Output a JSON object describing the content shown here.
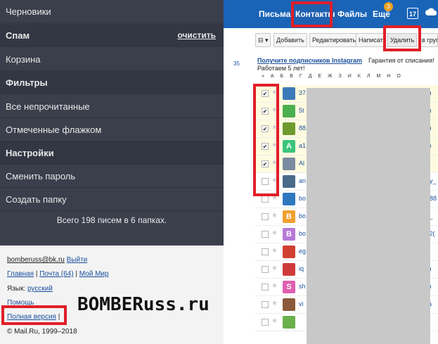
{
  "header": {
    "nav": [
      {
        "label": "Письма"
      },
      {
        "label": "Контакты"
      },
      {
        "label": "Файлы"
      },
      {
        "label": "Ещё"
      }
    ],
    "more_badge": "3",
    "calendar_day": "17",
    "cloud_icon": "cloud-icon"
  },
  "toolbar": {
    "select_label": "⊟ ▾",
    "add_label": "Добавить",
    "edit_label": "Редактировать",
    "write_label": "Написать",
    "delete_label": "Удалить",
    "group_label": "в групп"
  },
  "promo": {
    "link_text": "Получите подписчиков Instagram",
    "text": "Гарантия от списания!",
    "text2": "Работаем 5 лет!"
  },
  "left_count": "35",
  "alphabet": [
    "«",
    "А",
    "Б",
    "В",
    "Г",
    "Д",
    "Е",
    "Ж",
    "З",
    "И",
    "К",
    "Л",
    "М",
    "Н",
    "О"
  ],
  "contacts": [
    {
      "checked": true,
      "letter": "",
      "color": "#3d7ab8",
      "name": "37",
      "edge": "m"
    },
    {
      "checked": true,
      "letter": "",
      "color": "#4caf50",
      "name": "5t",
      "edge": "m"
    },
    {
      "checked": true,
      "letter": "",
      "color": "#6e9a2e",
      "name": "88",
      "edge": "m"
    },
    {
      "checked": true,
      "letter": "A",
      "color": "#3cc47c",
      "name": "a1",
      "edge": "m"
    },
    {
      "checked": true,
      "letter": "",
      "color": "#7a8aa0",
      "name": "Al",
      "edge": "u"
    },
    {
      "checked": false,
      "letter": "",
      "color": "#4a6a8a",
      "name": "an",
      "edge": "ey_"
    },
    {
      "checked": false,
      "letter": "",
      "color": "#2e78c0",
      "name": "bo",
      "edge": "b88"
    },
    {
      "checked": false,
      "letter": "B",
      "color": "#f0a030",
      "name": "bo",
      "edge": "s_"
    },
    {
      "checked": false,
      "letter": "B",
      "color": "#b57ad6",
      "name": "bo",
      "edge": "s2("
    },
    {
      "checked": false,
      "letter": "",
      "color": "#d04030",
      "name": "eg",
      "edge": "e"
    },
    {
      "checked": false,
      "letter": "",
      "color": "#d03a3a",
      "name": "iq",
      "edge": "m"
    },
    {
      "checked": false,
      "letter": "S",
      "color": "#e060b0",
      "name": "sh",
      "edge": "m"
    },
    {
      "checked": false,
      "letter": "",
      "color": "#8a5a3a",
      "name": "vi",
      "edge": "-a"
    },
    {
      "checked": false,
      "letter": "",
      "color": "#6ab04c",
      "name": "",
      "edge": ""
    }
  ],
  "menu": {
    "items": [
      {
        "label": "Черновики"
      },
      {
        "label": "Спам",
        "action": "очистить"
      },
      {
        "label": "Корзина"
      },
      {
        "label": "Фильтры"
      },
      {
        "label": "Все непрочитанные"
      },
      {
        "label": "Отмеченные флажком"
      },
      {
        "label": "Настройки"
      },
      {
        "label": "Сменить пароль"
      },
      {
        "label": "Создать папку"
      }
    ],
    "summary": "Всего 198 писем в 6 папках."
  },
  "footer": {
    "email": "bomberuss@bk.ru",
    "logout": "Выйти",
    "home": "Главная",
    "mail": "Почта (64)",
    "myworld": "Мой Мир",
    "language_label": "Язык:",
    "language": "русский",
    "help": "Помощь",
    "full_version": "Полная версия",
    "copyright": "© Mail.Ru, 1999–2018"
  },
  "watermark": "BOMBERuss.ru",
  "colors": {
    "header_bg": "#1a64b8",
    "menu_bg": "#3b3f4c",
    "highlight": "#e01f28"
  }
}
